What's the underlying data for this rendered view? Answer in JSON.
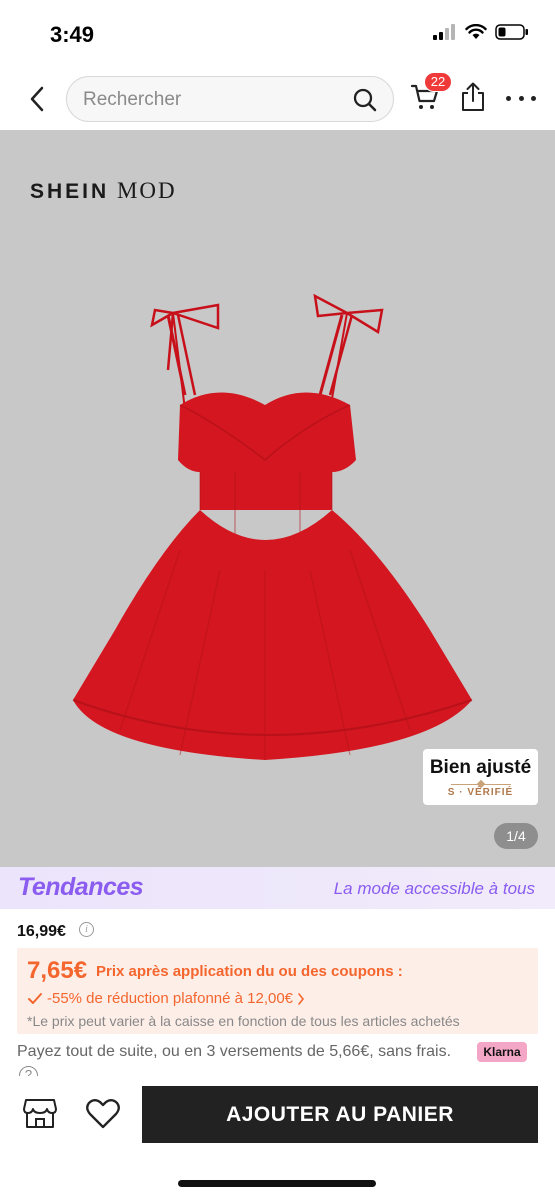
{
  "status_bar": {
    "time": "3:49"
  },
  "header": {
    "search_placeholder": "Rechercher",
    "cart_count": "22"
  },
  "product_image": {
    "brand_part1": "SHEIN",
    "brand_part2": "MOD",
    "fit_badge_title": "Bien ajusté",
    "fit_badge_verified": "S · VÉRIFIÉ",
    "page_indicator": "1/4",
    "dress_color": "#d3161f"
  },
  "trends": {
    "logo": "Tendances",
    "tagline": "La mode accessible à tous"
  },
  "price": {
    "original": "16,99€",
    "coupon_price": "7,65€",
    "coupon_label": "Prix après application du ou des coupons :",
    "discount": "-55% de réduction plafonné à 12,00€",
    "note": "*Le prix peut varier à la caisse en fonction de tous les articles achetés"
  },
  "payment": {
    "text": "Payez tout de suite, ou en 3 versements de 5,66€, sans frais.",
    "klarna": "Klarna"
  },
  "bottom_bar": {
    "add_to_cart": "AJOUTER AU PANIER"
  },
  "colors": {
    "accent_orange": "#f4662e",
    "trends_purple": "#8a5cf0",
    "badge_red": "#f03a3a",
    "button_dark": "#222222"
  }
}
